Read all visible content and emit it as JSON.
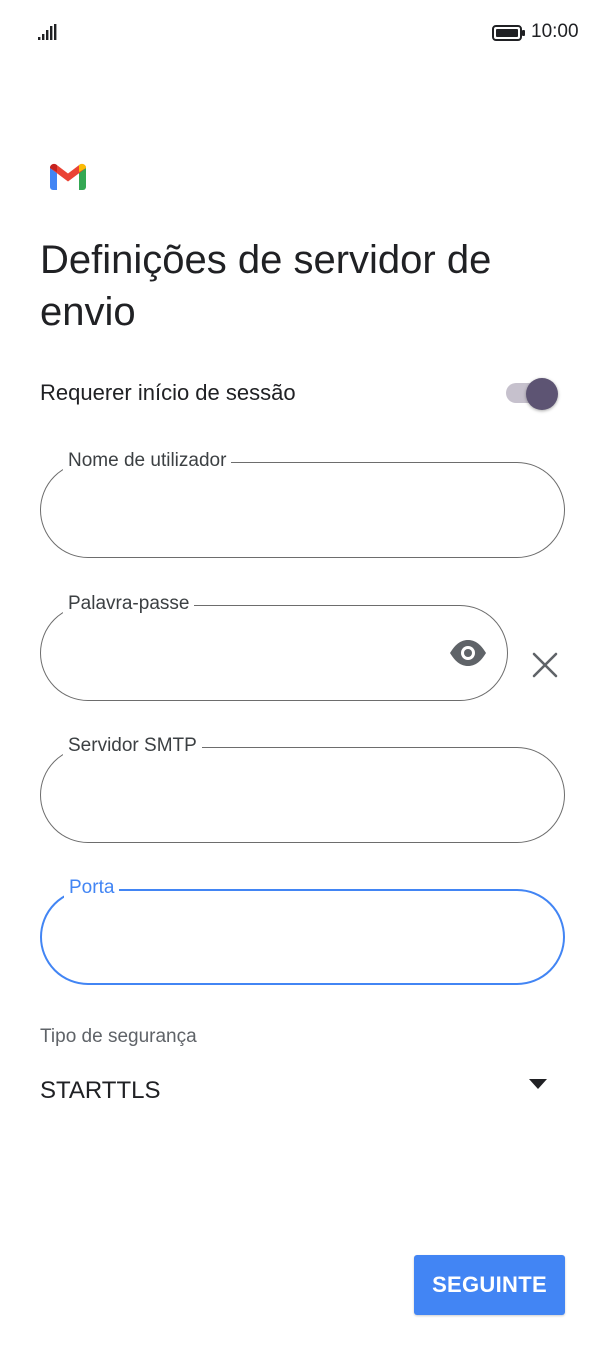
{
  "status_bar": {
    "time": "10:00",
    "signal_icon": "signal-bars-icon",
    "battery_icon": "battery-full-icon"
  },
  "app": {
    "logo": "gmail-logo",
    "colors": {
      "gmail_blue": "#4285f4",
      "gmail_red": "#ea4335",
      "gmail_yellow": "#fbbc04",
      "gmail_green": "#34a853"
    }
  },
  "page": {
    "title": "Definições de servidor de envio"
  },
  "login_toggle": {
    "label": "Requerer início de sessão",
    "checked": true
  },
  "fields": {
    "username": {
      "label": "Nome de utilizador",
      "value": ""
    },
    "password": {
      "label": "Palavra-passe",
      "value": "",
      "toggle_icon": "eye-icon",
      "clear_icon": "close-icon"
    },
    "smtp_server": {
      "label": "Servidor SMTP",
      "value": ""
    },
    "port": {
      "label": "Porta",
      "value": "",
      "focused": true
    }
  },
  "security": {
    "label": "Tipo de segurança",
    "value": "STARTTLS",
    "icon": "dropdown-arrow-icon"
  },
  "actions": {
    "next_label": "SEGUINTE"
  },
  "theme": {
    "accent": "#4285f4",
    "toggle_thumb": "#5d5473",
    "toggle_track": "#c6c1cd",
    "outline": "#6d6d6d"
  }
}
